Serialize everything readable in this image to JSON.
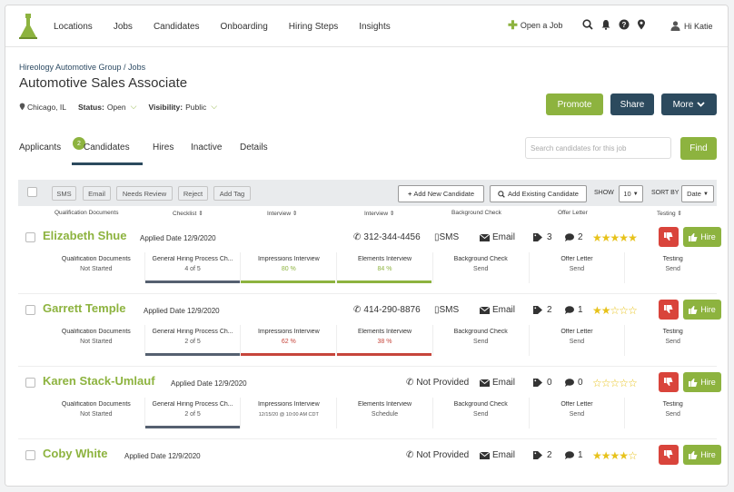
{
  "nav": {
    "items": [
      "Locations",
      "Jobs",
      "Candidates",
      "Onboarding",
      "Hiring Steps",
      "Insights"
    ],
    "open_job": "Open a Job",
    "user": "Hi Katie"
  },
  "header": {
    "breadcrumb": "Hireology Automotive Group / Jobs",
    "title": "Automotive Sales Associate",
    "location": "Chicago, IL",
    "status_label": "Status:",
    "status_value": "Open",
    "visibility_label": "Visibility:",
    "visibility_value": "Public",
    "promote": "Promote",
    "share": "Share",
    "more": "More"
  },
  "tabs": {
    "applicants": "Applicants",
    "applicants_count": "2",
    "candidates": "Candidates",
    "hires": "Hires",
    "inactive": "Inactive",
    "details": "Details",
    "search_placeholder": "Search candidates for this job",
    "find": "Find"
  },
  "toolbar": {
    "sms": "SMS",
    "email": "Email",
    "needs_review": "Needs Review",
    "reject": "Reject",
    "add_tag": "Add Tag",
    "add_new": "Add New Candidate",
    "add_existing": "Add Existing Candidate",
    "show_label": "SHOW",
    "show_value": "10",
    "sort_label": "SORT BY",
    "sort_value": "Date"
  },
  "columns": [
    "Qualification Documents",
    "Checklist",
    "Interview",
    "Interview",
    "Background Check",
    "Offer Letter",
    "Testing"
  ],
  "colors": {
    "green": "#8db33f",
    "navy": "#2c4a5e",
    "red": "#d9443b",
    "star": "#e7c21a"
  },
  "candidates": [
    {
      "name": "Elizabeth Shue",
      "applied": "Applied Date 12/9/2020",
      "phone": "312-344-4456",
      "sms": "SMS",
      "email": "Email",
      "tags": "3",
      "comments": "2",
      "rating": 5,
      "hire": "Hire",
      "stages": [
        {
          "title": "Qualification Documents",
          "status": "Not Started",
          "bar": ""
        },
        {
          "title": "General Hiring Process Ch...",
          "status": "4 of 5",
          "bar": "#556070"
        },
        {
          "title": "Impressions Interview",
          "status": "80 %",
          "bar": "#8db33f",
          "color": "#8db33f"
        },
        {
          "title": "Elements Interview",
          "status": "84 %",
          "bar": "#8db33f",
          "color": "#8db33f"
        },
        {
          "title": "Background Check",
          "status": "Send",
          "bar": ""
        },
        {
          "title": "Offer Letter",
          "status": "Send",
          "bar": ""
        },
        {
          "title": "Testing",
          "status": "Send",
          "bar": ""
        }
      ]
    },
    {
      "name": "Garrett Temple",
      "applied": "Applied Date 12/9/2020",
      "phone": "414-290-8876",
      "sms": "SMS",
      "email": "Email",
      "tags": "2",
      "comments": "1",
      "rating": 2,
      "hire": "Hire",
      "stages": [
        {
          "title": "Qualification Documents",
          "status": "Not Started",
          "bar": ""
        },
        {
          "title": "General Hiring Process Ch...",
          "status": "2 of 5",
          "bar": "#556070"
        },
        {
          "title": "Impressions Interview",
          "status": "62 %",
          "bar": "#c6453b",
          "color": "#c6453b"
        },
        {
          "title": "Elements Interview",
          "status": "38 %",
          "bar": "#c6453b",
          "color": "#c6453b"
        },
        {
          "title": "Background Check",
          "status": "Send",
          "bar": ""
        },
        {
          "title": "Offer Letter",
          "status": "Send",
          "bar": ""
        },
        {
          "title": "Testing",
          "status": "Send",
          "bar": ""
        }
      ]
    },
    {
      "name": "Karen Stack-Umlauf",
      "applied": "Applied Date 12/9/2020",
      "phone": "Not Provided",
      "sms": "",
      "email": "Email",
      "tags": "0",
      "comments": "0",
      "rating": 0,
      "hire": "Hire",
      "stages": [
        {
          "title": "Qualification Documents",
          "status": "Not Started",
          "bar": ""
        },
        {
          "title": "General Hiring Process Ch...",
          "status": "2 of 5",
          "bar": "#556070"
        },
        {
          "title": "Impressions Interview",
          "status": "12/15/20 @ 10:00 AM CDT",
          "bar": ""
        },
        {
          "title": "Elements Interview",
          "status": "Schedule",
          "bar": ""
        },
        {
          "title": "Background Check",
          "status": "Send",
          "bar": ""
        },
        {
          "title": "Offer Letter",
          "status": "Send",
          "bar": ""
        },
        {
          "title": "Testing",
          "status": "Send",
          "bar": ""
        }
      ]
    },
    {
      "name": "Coby White",
      "applied": "Applied Date 12/9/2020",
      "phone": "Not Provided",
      "sms": "",
      "email": "Email",
      "tags": "2",
      "comments": "1",
      "rating": 4,
      "hire": "Hire",
      "stages": []
    }
  ]
}
